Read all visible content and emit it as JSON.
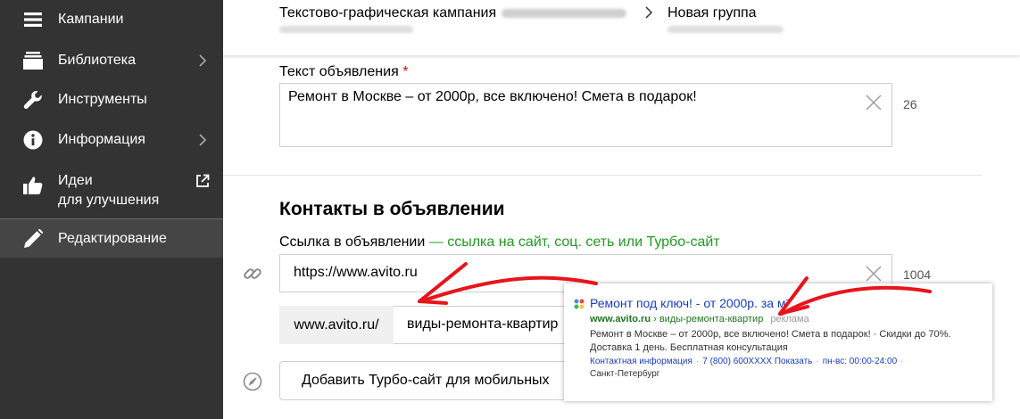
{
  "sidebar": {
    "items": [
      {
        "label": "Кампании",
        "icon": "menu-icon"
      },
      {
        "label": "Библиотека",
        "icon": "library-icon"
      },
      {
        "label": "Инструменты",
        "icon": "wrench-icon"
      },
      {
        "label": "Информация",
        "icon": "info-icon"
      },
      {
        "label": "Идеи",
        "label2": "для улучшения",
        "icon": "thumbs-up-icon"
      },
      {
        "label": "Редактирование",
        "icon": "pencil-icon"
      }
    ]
  },
  "header": {
    "campaign_title": "Текстово-графическая кампания",
    "group_title": "Новая группа"
  },
  "ad_text": {
    "label": "Текст объявления",
    "required_mark": "*",
    "value": "Ремонт в Москве – от 2000р, все включено! Смета в подарок!",
    "counter": "26"
  },
  "contacts": {
    "title": "Контакты в объявлении",
    "link_label": "Ссылка в объявлении",
    "link_hint": " — ссылка на сайт, соц. сеть или Турбо-сайт",
    "link_value": "https://www.avito.ru",
    "link_counter": "1004",
    "display_prefix": "www.avito.ru/",
    "display_value": "виды-ремонта-квартир",
    "turbo_button": "Добавить Турбо-сайт для мобильных"
  },
  "preview": {
    "title": "Ремонт под ключ! - от 2000р. за м²",
    "domain": "www.avito.ru",
    "path": " › виды-ремонта-квартир",
    "ad_label": "реклама",
    "text": "Ремонт в Москве – от 2000р, все включено! Смета в подарок! · Скидки до 70%. Доставка 1 день. Бесплатная консультация",
    "contact_info": "Контактная информация",
    "phone": "7 (800) 600XXXX Показать",
    "hours": "пн-вс: 00:00-24:00",
    "city": "Санкт-Петербург"
  },
  "colors": {
    "sidebar_bg": "#333333",
    "sidebar_active": "#454545",
    "hint_green": "#1f9b1f",
    "link_blue": "#1a3dc1",
    "arrow_red": "#e8141c"
  }
}
